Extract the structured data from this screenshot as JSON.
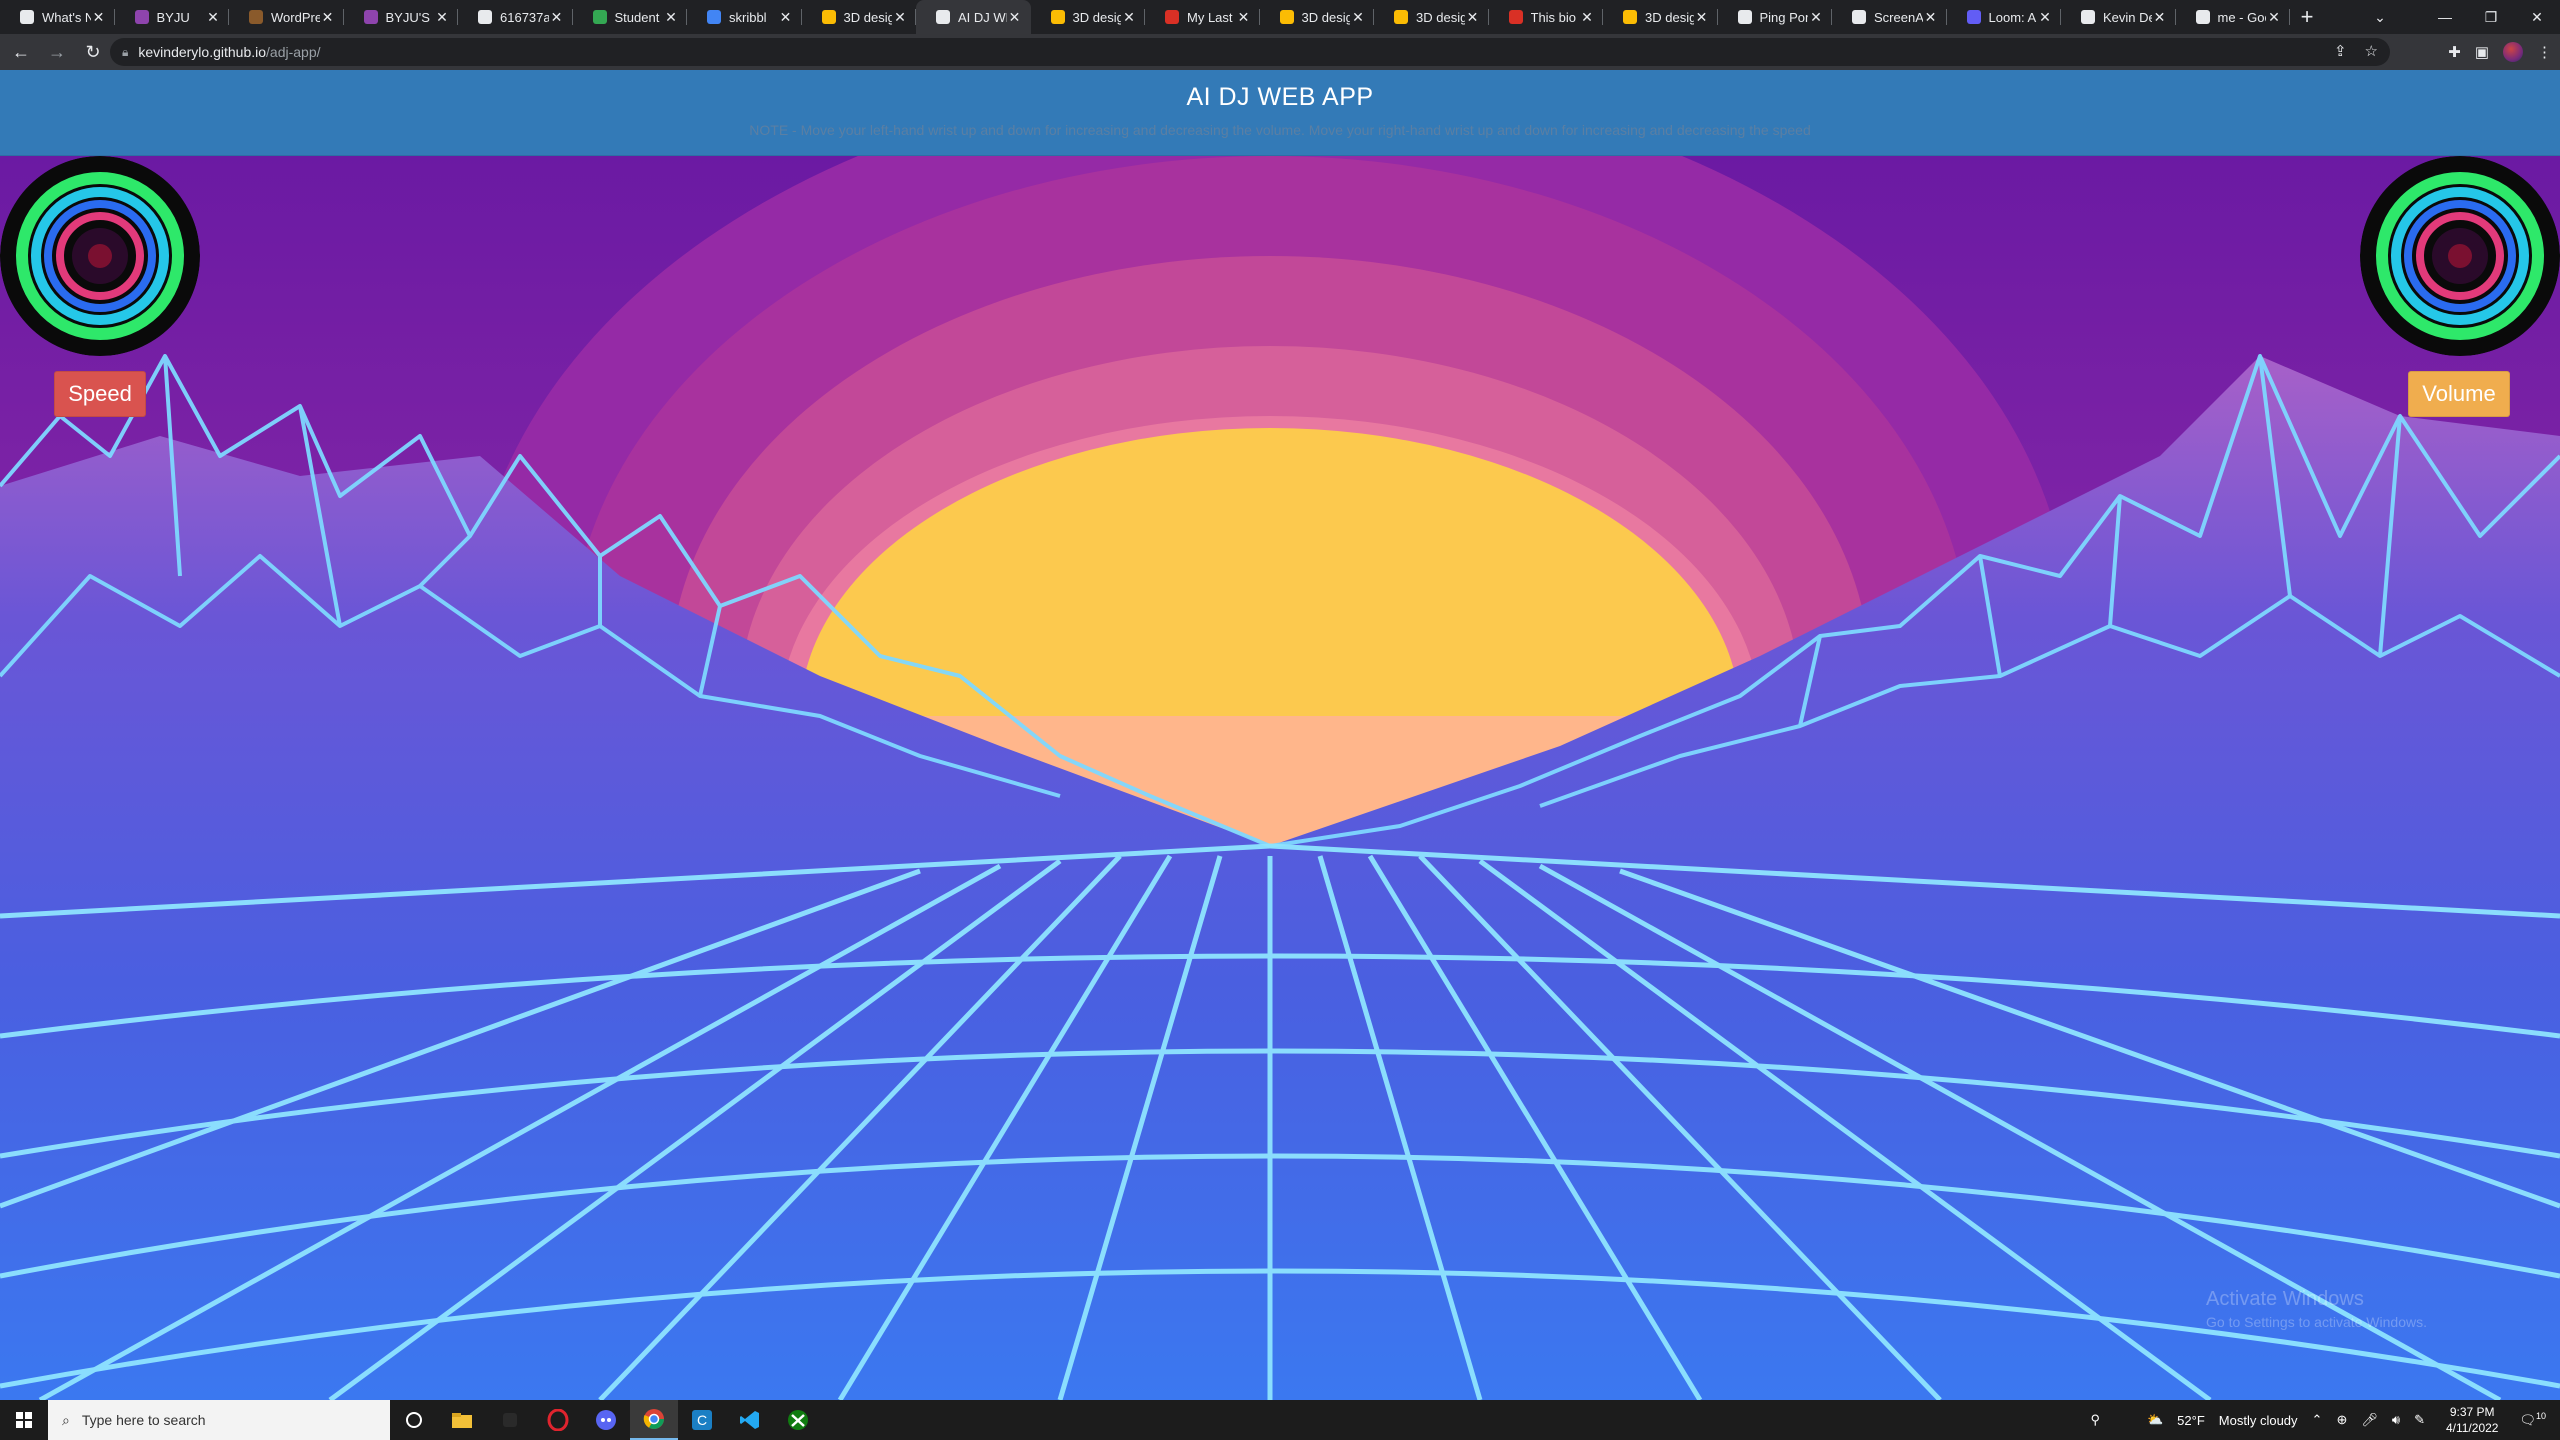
{
  "browser": {
    "tabs": [
      {
        "title": "What's N",
        "favicon": "#e8eaed"
      },
      {
        "title": "BYJU",
        "favicon": "#8e44ad"
      },
      {
        "title": "WordPre",
        "favicon": "#8a5a2b"
      },
      {
        "title": "BYJU'S F",
        "favicon": "#8e44ad"
      },
      {
        "title": "616737a",
        "favicon": "#e8eaed"
      },
      {
        "title": "Student",
        "favicon": "#34a853"
      },
      {
        "title": "skribbl",
        "favicon": "#4285f4"
      },
      {
        "title": "3D desig",
        "favicon": "#fbbc04"
      },
      {
        "title": "AI DJ WE",
        "favicon": "#e8eaed",
        "active": true
      },
      {
        "title": "3D desig",
        "favicon": "#fbbc04"
      },
      {
        "title": "My Last",
        "favicon": "#d93025"
      },
      {
        "title": "3D desig",
        "favicon": "#fbbc04"
      },
      {
        "title": "3D desig",
        "favicon": "#fbbc04"
      },
      {
        "title": "This bio",
        "favicon": "#d93025"
      },
      {
        "title": "3D desig",
        "favicon": "#fbbc04"
      },
      {
        "title": "Ping Pon",
        "favicon": "#e8eaed"
      },
      {
        "title": "ScreenA",
        "favicon": "#e8eaed"
      },
      {
        "title": "Loom: A",
        "favicon": "#625df5"
      },
      {
        "title": "Kevin De",
        "favicon": "#e8eaed"
      },
      {
        "title": "me - Goo",
        "favicon": "#e8eaed"
      }
    ],
    "url_host": "kevinderylo.github.io",
    "url_path": "/adj-app/"
  },
  "app": {
    "title": "AI DJ WEB APP",
    "note": "NOTE - Move your left-hand wrist up and down for increasing and decreasing the volume. Move your right-hand wrist up and down for increasing and decreasing the speed",
    "speed_label": "Speed",
    "volume_label": "Volume",
    "colors": {
      "header": "#337ab7",
      "speed": "#d9534f",
      "volume": "#f0ad4e",
      "sun": "#fcc94e",
      "grid": "#7fd8ff"
    }
  },
  "watermark": {
    "line1": "Activate Windows",
    "line2": "Go to Settings to activate Windows."
  },
  "taskbar": {
    "search_placeholder": "Type here to search",
    "temperature": "52°F",
    "weather": "Mostly cloudy",
    "time": "9:37 PM",
    "date": "4/11/2022",
    "notifications": "10"
  }
}
